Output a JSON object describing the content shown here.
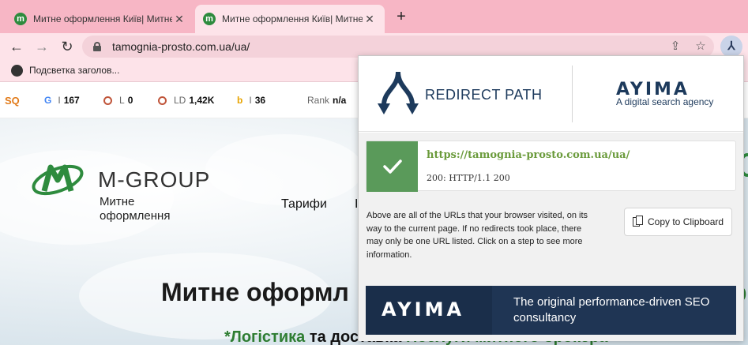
{
  "browser": {
    "tabs": [
      {
        "title": "Митне оформлення Київ| Митне",
        "favicon": "m-group-icon",
        "active": false
      },
      {
        "title": "Митне оформлення Київ| Митне",
        "favicon": "m-group-icon",
        "active": true
      }
    ],
    "new_tab_symbol": "+",
    "url": "tamognia-prosto.com.ua/ua/",
    "bookmarks": [
      {
        "label": "Подсветка заголов..."
      }
    ]
  },
  "seo_bar": {
    "logo": "SQ",
    "google_index": {
      "label": "I",
      "value": "167"
    },
    "links": {
      "label": "L",
      "value": "0"
    },
    "linking_domains": {
      "label": "LD",
      "value": "1,42K"
    },
    "bing_index": {
      "label": "I",
      "value": "36"
    },
    "rank": {
      "label": "Rank",
      "value": "n/a"
    }
  },
  "site": {
    "name": "M-GROUP",
    "tagline": "Митне оформлення",
    "nav_tariffs": "Тарифи",
    "nav_next": "І",
    "hero_title": "Митне оформл",
    "hero_edge": "р",
    "subline_prefix": "*",
    "subline_logistics": "Логістика",
    "subline_middle": " та доставка ",
    "subline_services": "Послуги митного брокера"
  },
  "redirect_path": {
    "title": "REDIRECT PATH",
    "partner_name": "AYIMA",
    "partner_tagline": "A digital search agency",
    "results": [
      {
        "url": "https://tamognia-prosto.com.ua/ua/",
        "status": "200: HTTP/1.1 200",
        "status_color": "#5a9a5a"
      }
    ],
    "info_text": "Above are all of the URLs that your browser visited, on its way to the current page. If no redirects took place, there may only be one URL listed. Click on a step to see more information.",
    "copy_button": "Copy to Clipboard",
    "banner_brand": "AYIMA",
    "banner_text": "The original performance-driven SEO consultancy"
  },
  "colors": {
    "tabstrip": "#f7b6c5",
    "toolbar": "#fde3e9",
    "success": "#5a9a5a",
    "brand_navy": "#1d3a5c",
    "site_green": "#2e7d32"
  }
}
